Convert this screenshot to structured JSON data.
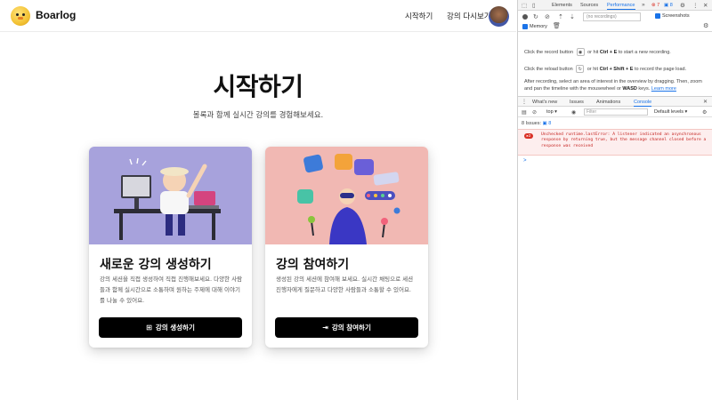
{
  "app": {
    "brand": "Boarlog",
    "nav": {
      "start": "시작하기",
      "rejoin": "강의 다시보기"
    },
    "hero": {
      "title": "시작하기",
      "subtitle": "볼록과 함께 실시간 강의를 경험해보세요."
    },
    "cards": [
      {
        "title": "새로운 강의 생성하기",
        "description": "강의 세션을 직접 생성하여 직접 진행해보세요. 다양한 사람들과 함께 실시간으로 소통하며 원하는 주제에 대해 이야기를 나눌 수 있어요.",
        "button": "강의 생성하기",
        "button_icon": "add-square-icon",
        "art_color": "#a7a2dc"
      },
      {
        "title": "강의 참여하기",
        "description": "생성된 강의 세션에 참여해 보세요. 실시간 채팅으로 세션 진행자에게 질문하고 다양한 사람들과 소통할 수 있어요.",
        "button": "강의 참여하기",
        "button_icon": "login-arrow-icon",
        "art_color": "#f1b8b3"
      }
    ]
  },
  "devtools": {
    "tabs": [
      "Elements",
      "Sources",
      "Performance"
    ],
    "active_tab": "Performance",
    "error_count": "7",
    "info_count": "8",
    "recording_select": "(no recordings)",
    "screenshots_label": "Screenshots",
    "memory_label": "Memory",
    "msg_record_1": "Click the record button",
    "msg_record_2": "or hit",
    "msg_record_keys": "Ctrl + E",
    "msg_record_3": "to start a new recording.",
    "msg_reload_1": "Click the reload button",
    "msg_reload_2": "or hit",
    "msg_reload_keys": "Ctrl + Shift + E",
    "msg_reload_3": "to record the page load.",
    "msg_after_1": "After recording, select an area of interest in the overview by dragging. Then, zoom and pan the timeline with the mousewheel or",
    "msg_after_keys": "WASD",
    "msg_after_2": "keys.",
    "learn_more": "Learn more",
    "drawer_tabs": [
      "What's new",
      "Issues",
      "Animations",
      "Console"
    ],
    "drawer_active": "Console",
    "context": "top",
    "filter_placeholder": "Filter",
    "levels": "Default levels",
    "issues_text": "8 Issues:",
    "issues_count": "8",
    "error_badge": "2",
    "error_message": "Unchecked runtime.lastError: A listener indicated an asynchronous response by returning true, but the message channel closed before a response was received",
    "prompt": ">"
  }
}
